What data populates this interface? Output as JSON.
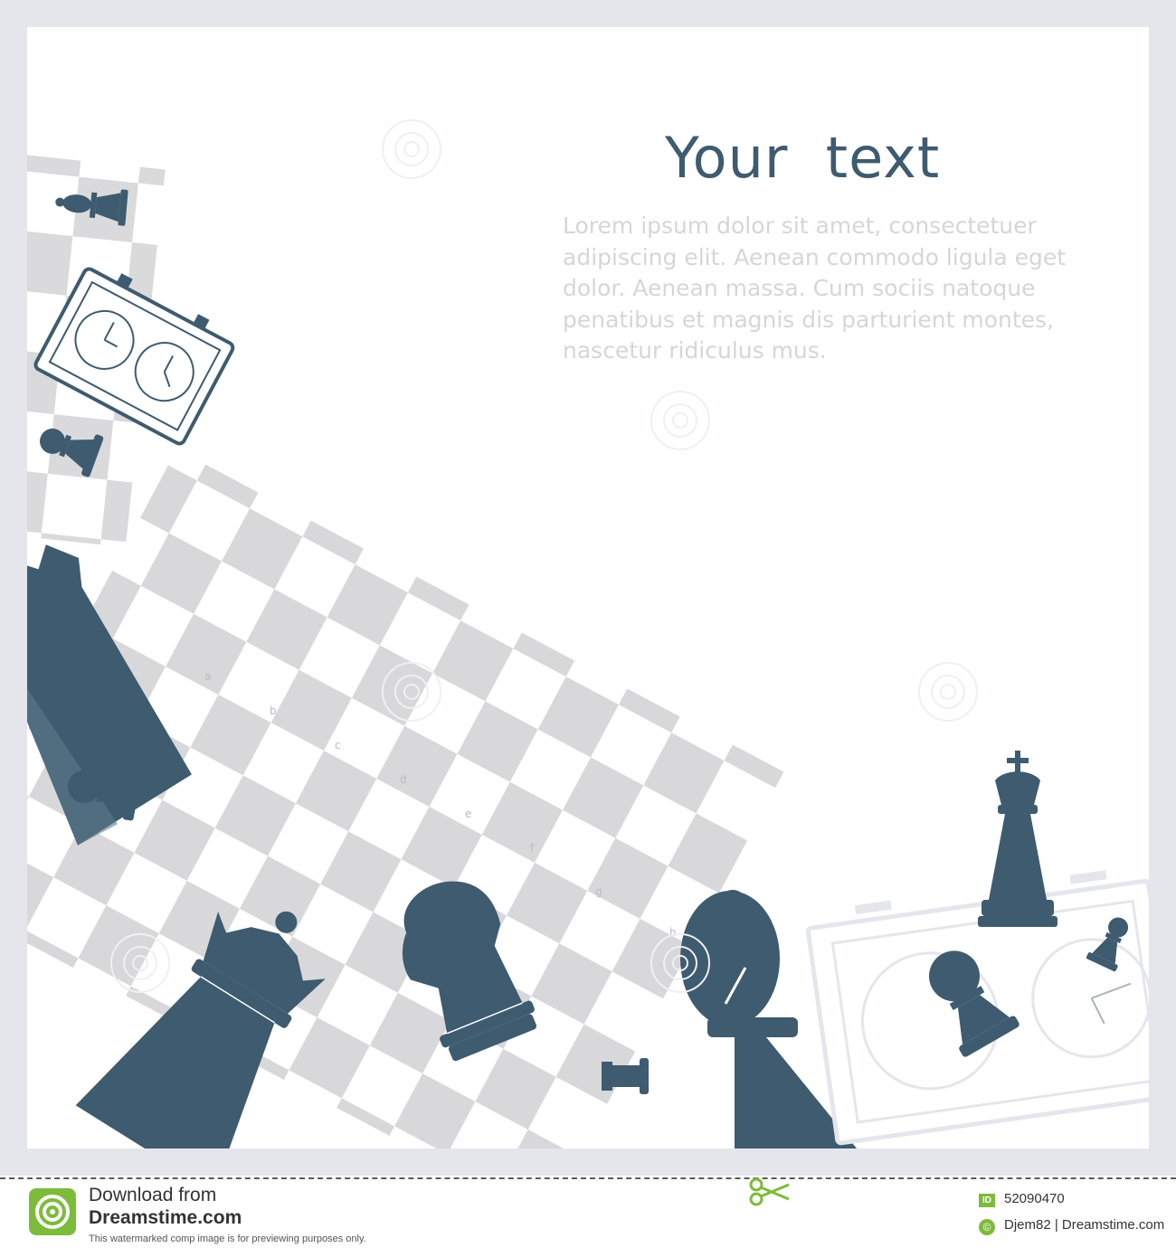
{
  "artwork": {
    "heading": "Your  text",
    "body_lines": [
      "Lorem ipsum dolor sit amet, consectetuer",
      "adipiscing elit. Aenean commodo ligula eget",
      "dolor. Aenean massa. Cum sociis natoque",
      "penatibus et magnis dis parturient montes,",
      "nascetur ridiculus mus."
    ],
    "board_file_letters": [
      "a",
      "b",
      "c",
      "d",
      "e",
      "f",
      "g",
      "h"
    ],
    "watermark_text": "dreamstime",
    "colors": {
      "piece": "#3e5b6f",
      "board_dark": "#d8d8da",
      "frame": "#e4e6eb",
      "lorem_text": "#d4d6da"
    },
    "icons": [
      "queen-icon",
      "knight-icon",
      "bishop-icon",
      "king-icon",
      "pawn-icon",
      "rook-icon",
      "chess-clock-icon",
      "scissors-icon"
    ]
  },
  "footer": {
    "download_from": "Download from",
    "site": "Dreamstime.com",
    "notice": "This watermarked comp image is for previewing purposes only.",
    "id_label": "ID",
    "id_value": "52090470",
    "copyright_symbol": "©",
    "credit": "Djem82 | Dreamstime.com"
  }
}
